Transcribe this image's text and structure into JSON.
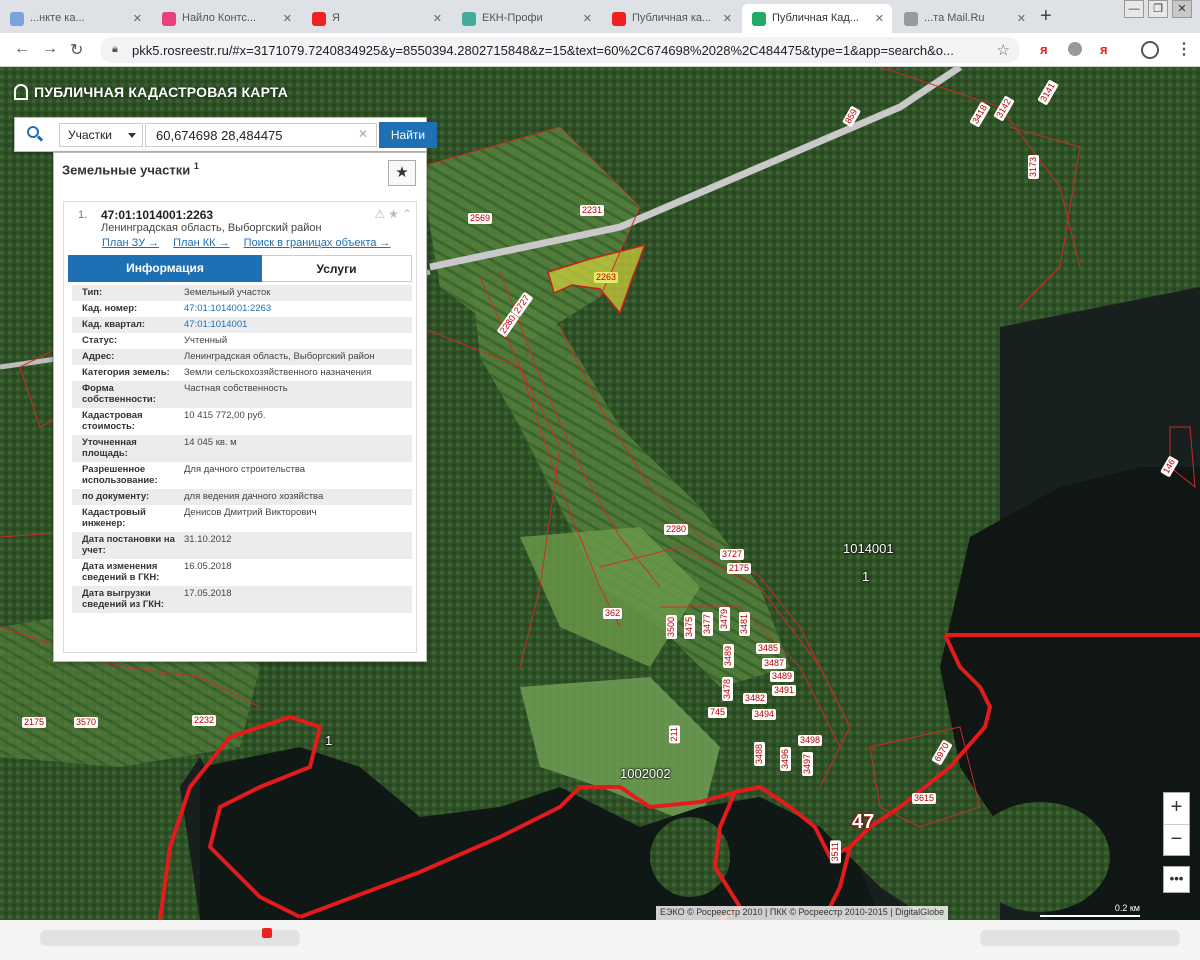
{
  "browser": {
    "tabs": [
      {
        "label": "...нкте ка...",
        "color": "#7aa3d9"
      },
      {
        "label": "Найло Контс...",
        "color": "#e8407a"
      },
      {
        "label": "Я",
        "color": "#e22"
      },
      {
        "label": "ЕКН-Профи",
        "color": "#4a9"
      },
      {
        "label": "Публичная ка...",
        "color": "#e22"
      },
      {
        "label": "Публичная Кад...",
        "color": "#2a6"
      },
      {
        "label": "...та Mail.Ru",
        "color": "#999"
      }
    ],
    "new_tab": "+",
    "url": "pkk5.rosreestr.ru/#x=3171079.7240834925&y=8550394.2802715848&z=15&text=60%2C674698%2028%2C484475&type=1&app=search&o...",
    "ext_yandex": "я"
  },
  "map": {
    "title": "ПУБЛИЧНАЯ КАДАСТРОВАЯ КАРТА",
    "copyright": "ЕЭКО © Росреестр 2010 | ПКК © Росреестр 2010-2015 | DigitalGlobe",
    "scale": "0.2 км",
    "quarters": [
      "1014001",
      "1002002"
    ],
    "big": [
      "47",
      "1",
      "1"
    ],
    "parcels": [
      "2569",
      "2231",
      "2263",
      "2727",
      "2280",
      "2280",
      "3727",
      "2175",
      "362",
      "3500",
      "3475",
      "3477",
      "3479",
      "3481",
      "3489",
      "3485",
      "3487",
      "3489",
      "3478",
      "3482",
      "3494",
      "3491",
      "745",
      "211",
      "3488",
      "3497",
      "3496",
      "3498",
      "6970",
      "3615",
      "2175",
      "3570",
      "2232",
      "146",
      "859",
      "3141",
      "3142",
      "3418",
      "3173",
      "3511"
    ]
  },
  "search": {
    "type_selected": "Участки",
    "query": "60,674698 28,484475",
    "find_label": "Найти"
  },
  "results": {
    "header": "Земельные участки",
    "count": "1",
    "item": {
      "num": "1.",
      "title": "47:01:1014001:2263",
      "address": "Ленинградская область, Выборгский район",
      "links": [
        "План ЗУ →",
        "План КК →",
        "Поиск в границах объекта →"
      ]
    },
    "tabs": {
      "info": "Информация",
      "services": "Услуги"
    },
    "attributes": [
      {
        "k": "Тип:",
        "v": "Земельный участок"
      },
      {
        "k": "Кад. номер:",
        "v": "47:01:1014001:2263"
      },
      {
        "k": "Кад. квартал:",
        "v": "47:01:1014001"
      },
      {
        "k": "Статус:",
        "v": "Учтенный"
      },
      {
        "k": "Адрес:",
        "v": "Ленинградская область, Выборгский район"
      },
      {
        "k": "Категория земель:",
        "v": "Земли сельскохозяйственного назначения"
      },
      {
        "k": "Форма собственности:",
        "v": "Частная собственность"
      },
      {
        "k": "Кадастровая стоимость:",
        "v": "10 415 772,00 руб."
      },
      {
        "k": "Уточненная площадь:",
        "v": "14 045 кв. м"
      },
      {
        "k": "Разрешенное использование:",
        "v": "Для дачного строительства"
      },
      {
        "k": "по документу:",
        "v": "для ведения дачного хозяйства"
      },
      {
        "k": "Кадастровый инженер:",
        "v": "Денисов Дмитрий Викторович"
      },
      {
        "k": "Дата постановки на учет:",
        "v": "31.10.2012"
      },
      {
        "k": "Дата изменения сведений в ГКН:",
        "v": "16.05.2018"
      },
      {
        "k": "Дата выгрузки сведений из ГКН:",
        "v": "17.05.2018"
      }
    ]
  },
  "controls": {
    "zoom_in": "+",
    "zoom_out": "−",
    "more": "•••"
  }
}
